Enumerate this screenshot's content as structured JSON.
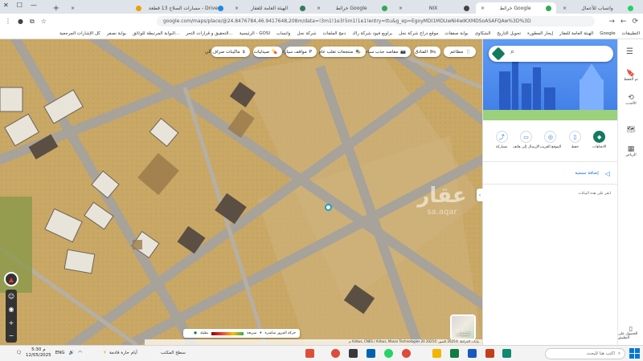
{
  "browser": {
    "tabs": [
      {
        "title": "واتساب للأعمال",
        "color": "#25d366",
        "active": false
      },
      {
        "title": "خرائط Google",
        "color": "#34a853",
        "active": true
      },
      {
        "title": "NIX",
        "color": "#444444",
        "active": false
      },
      {
        "title": "خرائط Google",
        "color": "#34a853",
        "active": false
      },
      {
        "title": "الهيئة العامة للعقار",
        "color": "#2f7d5d",
        "active": false
      },
      {
        "title": "مسارات الصلاح 13 قطعة - Drive",
        "color": "#1e88e5",
        "active": false
      },
      {
        "title": "",
        "color": "#e8a400",
        "active": false
      }
    ],
    "new_tab": "+",
    "window_controls": [
      "—",
      "☐",
      "✕"
    ],
    "url": "google.com/maps/place/@24.8476784,46.9417648,208m/data=!3m1!1e3!5m1!1e1!entry=ttu&g_ep=EgoyMDI1MDUwNi4wIKXMDSoASAFQAw%3D%3D",
    "bookmarks": [
      "التطبيقات",
      "Google",
      "الهيئة العامة للعقار",
      "إيجار المطورة",
      "تحويل التاريخ",
      "الشكاوى",
      "بوابة صفقات",
      "موقع دراج شركة نجل",
      "براويع فيود شركة راك",
      "دمج الملفات",
      "شركة نجل",
      "واتساب",
      "الرئيسية - GOSI",
      "التحقيق و قرارات التحر...",
      "البوابة المرتبطة للوثائق...",
      "بوابة نصفر",
      "كل الإشارات المرجعية"
    ]
  },
  "map": {
    "chips": [
      "مطاعم",
      "الفنادق",
      "مقاصد جذب سياحية",
      "منتجعات تغلب عام",
      "مواقف سيارات",
      "صيدليات",
      "ماكينات صراف آلي"
    ],
    "chip_icons": [
      "🍴",
      "🛏",
      "📷",
      "🎭",
      "P",
      "💊",
      "$"
    ],
    "layers_label": "الطبقات",
    "traffic_label": "حركة المرور مباشرة",
    "traffic_speed_fast": "سريعة",
    "traffic_speed_slow": "بطيئة",
    "attribution": "بيانات الخرائط ©2025 الصور ©2025 Airbus, CNES / Airbus, Maxar Technologies 20 م",
    "watermark_site": "sa.aqar",
    "watermark_word": "عقار",
    "zoom_in": "+",
    "zoom_out": "−"
  },
  "panel": {
    "actions": [
      {
        "label": "الاتجاهات",
        "icon": "◆"
      },
      {
        "label": "حفظ",
        "icon": "▯"
      },
      {
        "label": "الموقع القريب",
        "icon": "◎"
      },
      {
        "label": "الإرسال إلى هاتف",
        "icon": "▭"
      },
      {
        "label": "مشاركة",
        "icon": "⤴"
      }
    ],
    "add_label": "إضافة تسمية",
    "info_text": "اعثر على هذه البيانات"
  },
  "rail": {
    "items": [
      {
        "label": "تم الحفظ",
        "icon": "🔖"
      },
      {
        "label": "الأحدث",
        "icon": "⟲"
      },
      {
        "label": "",
        "icon": "🗺"
      },
      {
        "label": "الرياض",
        "icon": "▦"
      }
    ],
    "bottom_label": "الحصول على التطبيق"
  },
  "taskbar": {
    "search_placeholder": "اكتب هنا للبحث",
    "weather": "أيام حارة قادمة",
    "time": "5:30 م",
    "date": "12/05/2025",
    "lang": "ENG",
    "desktop_label": "سطح المكتب"
  },
  "colors": {
    "map_sand": "#c9a765",
    "road": "#a7a29a",
    "accent_green": "#137a5f",
    "panel_blue": "#4a8ff0"
  }
}
